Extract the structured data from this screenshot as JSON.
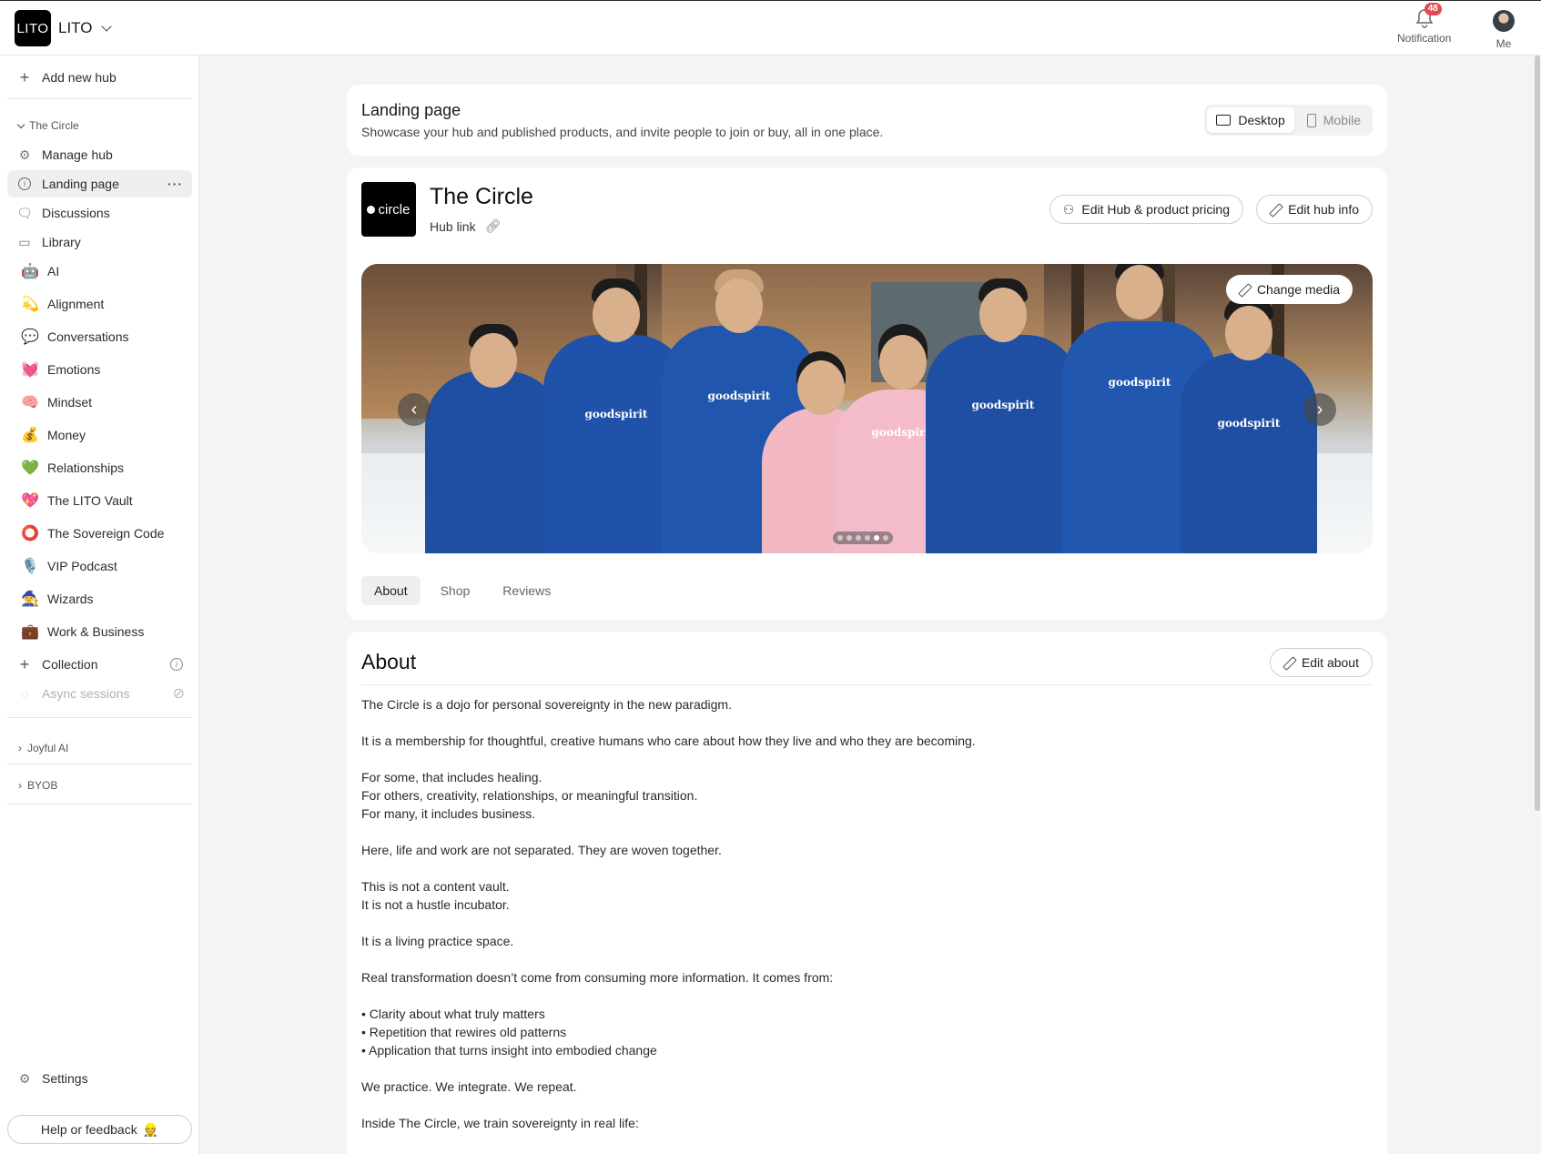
{
  "app": {
    "logo_text": "LITO",
    "name": "LITO"
  },
  "topbar": {
    "notification_label": "Notification",
    "notification_count": "48",
    "me_label": "Me"
  },
  "sidebar": {
    "add_hub": "Add new hub",
    "group_current": "The Circle",
    "items": [
      {
        "label": "Manage hub",
        "icon": "gear-icon"
      },
      {
        "label": "Landing page",
        "icon": "info-icon",
        "active": true
      },
      {
        "label": "Discussions",
        "icon": "chat-icon"
      },
      {
        "label": "Library",
        "icon": "library-icon"
      }
    ],
    "spaces": [
      {
        "emoji": "🤖",
        "label": "AI"
      },
      {
        "emoji": "💫",
        "label": "Alignment"
      },
      {
        "emoji": "💬",
        "label": "Conversations"
      },
      {
        "emoji": "💓",
        "label": "Emotions"
      },
      {
        "emoji": "🧠",
        "label": "Mindset"
      },
      {
        "emoji": "💰",
        "label": "Money"
      },
      {
        "emoji": "💚",
        "label": "Relationships"
      },
      {
        "emoji": "💖",
        "label": "The LITO Vault"
      },
      {
        "emoji": "⭕",
        "label": "The Sovereign Code"
      },
      {
        "emoji": "🎙️",
        "label": "VIP Podcast"
      },
      {
        "emoji": "🧙",
        "label": "Wizards"
      },
      {
        "emoji": "💼",
        "label": "Work & Business"
      }
    ],
    "collection": "Collection",
    "async_sessions": "Async sessions",
    "group_joyful": "Joyful AI",
    "group_byob": "BYOB",
    "settings": "Settings",
    "help": "Help or feedback",
    "help_emoji": "👷"
  },
  "landing": {
    "title": "Landing page",
    "subtitle": "Showcase your hub and published products, and invite people to join or buy, all in one place.",
    "view_desktop": "Desktop",
    "view_mobile": "Mobile"
  },
  "hub": {
    "logo_text": "circle",
    "name": "The Circle",
    "link_label": "Hub link",
    "edit_pricing": "Edit Hub & product pricing",
    "edit_info": "Edit hub info",
    "change_media": "Change media",
    "hoodie_text": "goodspirit",
    "tabs": [
      "About",
      "Shop",
      "Reviews"
    ]
  },
  "about": {
    "title": "About",
    "edit": "Edit about",
    "body": "The Circle is a dojo for personal sovereignty in the new paradigm.\n\nIt is a membership for thoughtful, creative humans who care about how they live and who they are becoming.\n\nFor some, that includes healing.\nFor others, creativity, relationships, or meaningful transition.\nFor many, it includes business.\n\nHere, life and work are not separated. They are woven together.\n\nThis is not a content vault.\nIt is not a hustle incubator.\n\nIt is a living practice space.\n\nReal transformation doesn’t come from consuming more information. It comes from:\n\n• Clarity about what truly matters\n• Repetition that rewires old patterns\n• Application that turns insight into embodied change\n\nWe practice. We integrate. We repeat.\n\nInside The Circle, we train sovereignty in real life:"
  },
  "colors": {
    "accent_badge": "#e5484d",
    "hoodie_blue": "#1e4fa3",
    "hoodie_pink": "#f2b8c4"
  }
}
